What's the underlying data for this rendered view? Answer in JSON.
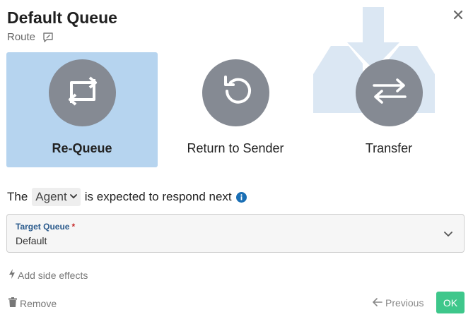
{
  "header": {
    "title": "Default Queue",
    "subtitle": "Route",
    "note_icon": "note-edit-icon",
    "close_icon": "close-icon"
  },
  "options": [
    {
      "label": "Re-Queue",
      "icon": "requeue-icon",
      "selected": true
    },
    {
      "label": "Return to Sender",
      "icon": "undo-icon",
      "selected": false
    },
    {
      "label": "Transfer",
      "icon": "swap-icon",
      "selected": false
    }
  ],
  "respond": {
    "prefix": "The",
    "selected": "Agent",
    "suffix": "is expected to respond next"
  },
  "target_queue": {
    "label": "Target Queue",
    "required_mark": "*",
    "value": "Default"
  },
  "actions": {
    "side_effects": "Add side effects",
    "remove": "Remove",
    "previous": "Previous",
    "ok": "OK"
  },
  "colors": {
    "selected_bg": "#b6d4ef",
    "circle": "#858a93",
    "ok": "#3ec78b",
    "label_blue": "#2a5a8c",
    "required": "#c62828"
  }
}
